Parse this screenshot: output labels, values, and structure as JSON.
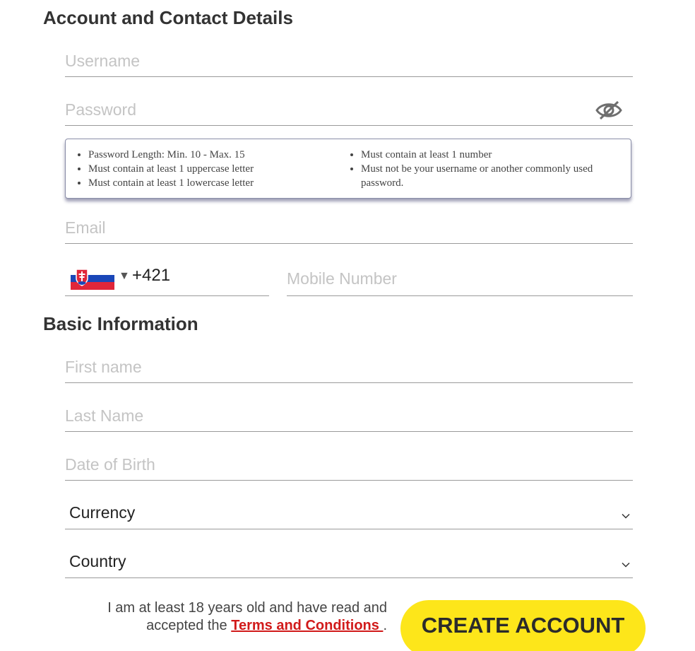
{
  "sections": {
    "account_title": "Account and Contact Details",
    "basic_title": "Basic Information"
  },
  "fields": {
    "username_placeholder": "Username",
    "password_placeholder": "Password",
    "email_placeholder": "Email",
    "mobile_placeholder": "Mobile Number",
    "first_name_placeholder": "First name",
    "last_name_placeholder": "Last Name",
    "dob_placeholder": "Date of Birth"
  },
  "password_rules": {
    "left": [
      "Password Length: Min. 10 - Max. 15",
      "Must contain at least 1 uppercase letter",
      "Must contain at least 1 lowercase letter"
    ],
    "right": [
      "Must contain at least 1 number",
      "Must not be your username or another commonly used password."
    ]
  },
  "phone": {
    "dial_code": "+421",
    "flag_icon": "slovakia-flag-icon",
    "caret": "▼"
  },
  "selects": {
    "currency_label": "Currency",
    "country_label": "Country"
  },
  "consent": {
    "text_before": "I am at least 18 years old and have read and accepted the ",
    "link_text": "Terms and Conditions ",
    "text_after": "."
  },
  "actions": {
    "create_account_label": "CREATE ACCOUNT"
  },
  "colors": {
    "accent_button": "#fde61a",
    "link": "#d11a1a"
  }
}
